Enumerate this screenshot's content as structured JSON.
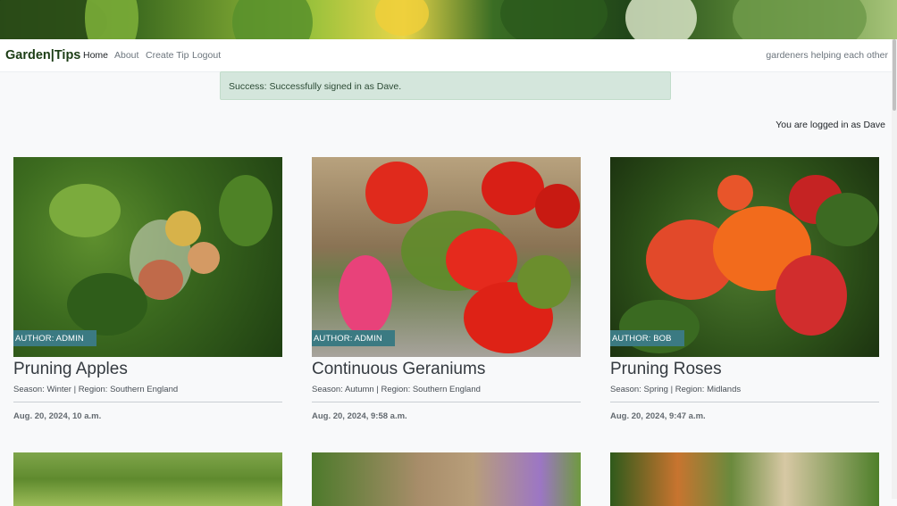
{
  "nav": {
    "brand": "Garden|Tips",
    "links": [
      "Home",
      "About",
      "Create Tip",
      "Logout"
    ],
    "tagline": "gardeners helping each other"
  },
  "alert": {
    "text": "Success: Successfully signed in as Dave."
  },
  "status": {
    "logged_in": "You are logged in as Dave"
  },
  "cards": [
    {
      "author": "AUTHOR: ADMIN",
      "title": "Pruning Apples",
      "meta": "Season: Winter | Region: Southern England",
      "date": "Aug. 20, 2024, 10 a.m."
    },
    {
      "author": "AUTHOR: ADMIN",
      "title": "Continuous Geraniums",
      "meta": "Season: Autumn | Region: Southern England",
      "date": "Aug. 20, 2024, 9:58 a.m."
    },
    {
      "author": "AUTHOR: BOB",
      "title": "Pruning Roses",
      "meta": "Season: Spring | Region: Midlands",
      "date": "Aug. 20, 2024, 9:47 a.m."
    }
  ],
  "colors": {
    "badge": "#3b7a82",
    "alert_bg": "#d4e6dc",
    "brand": "#1c3d15"
  }
}
